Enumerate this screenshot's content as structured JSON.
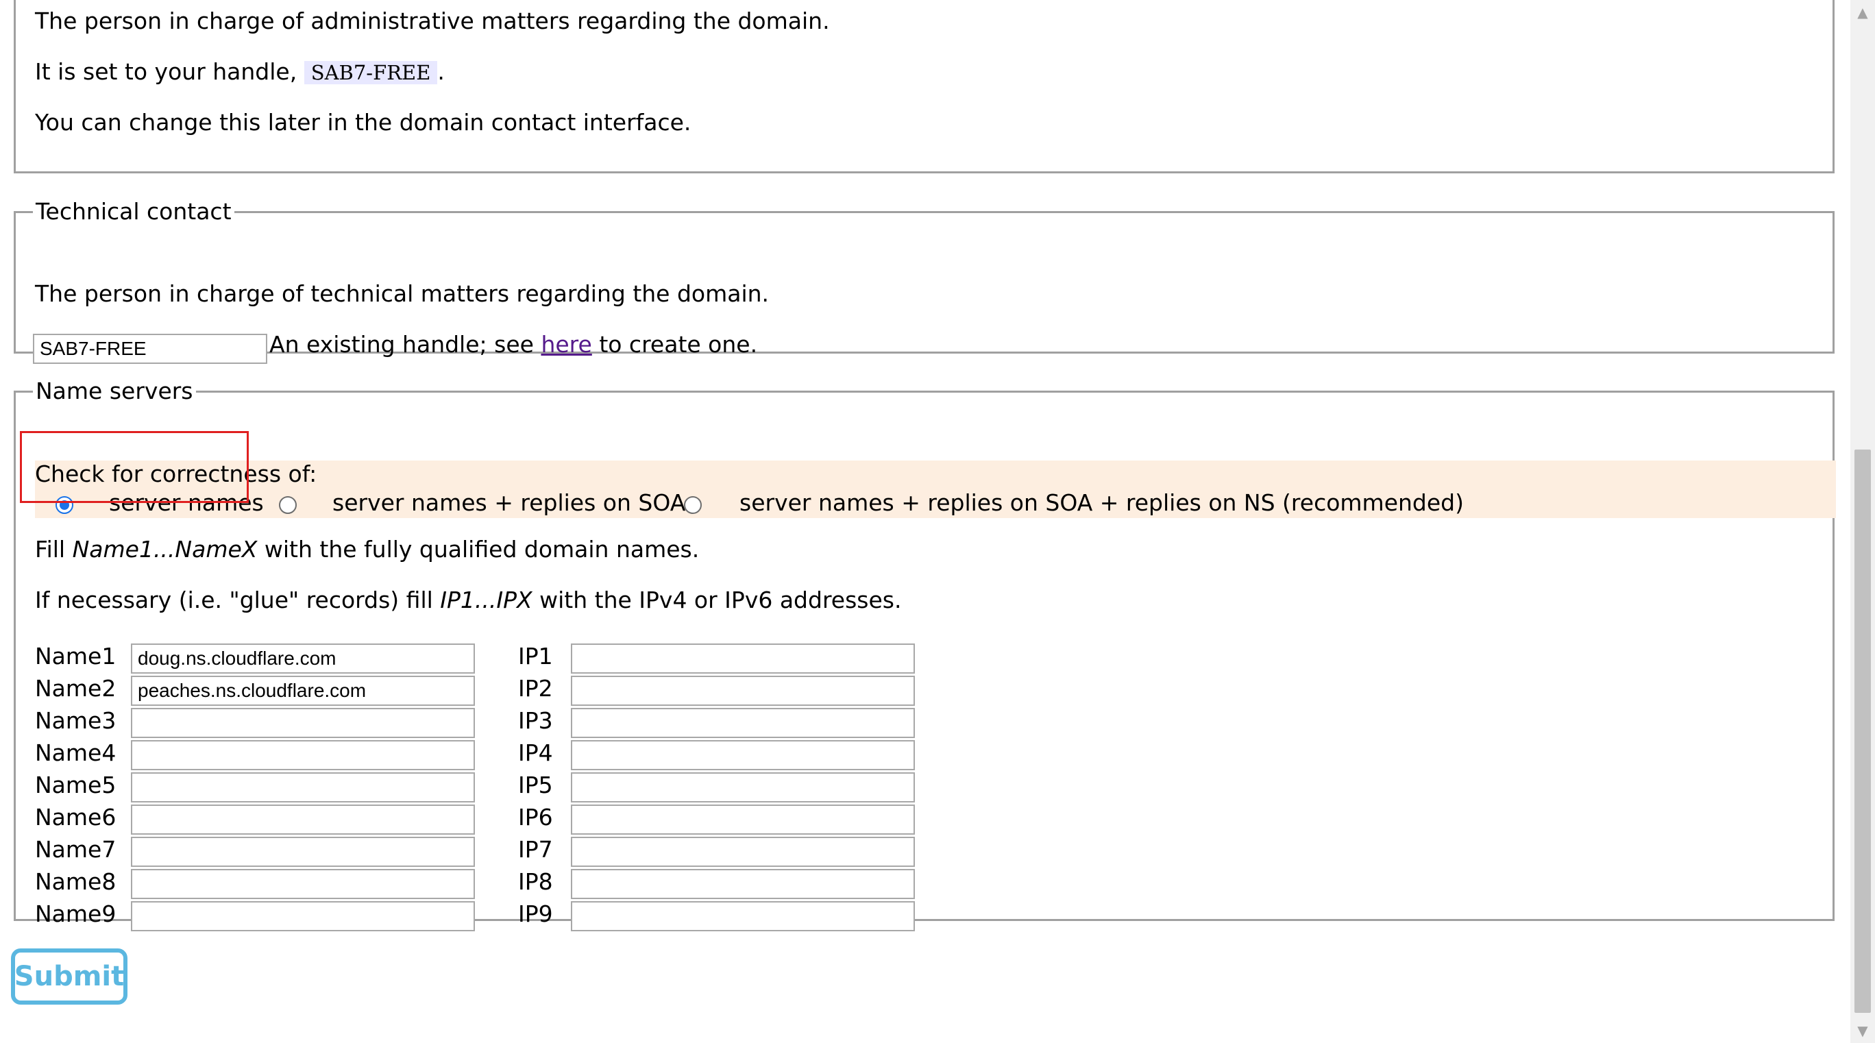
{
  "admin_contact": {
    "description": "The person in charge of administrative matters regarding the domain.",
    "handle_prefix": "It is set to your handle,",
    "handle": "SAB7-FREE",
    "handle_suffix": ".",
    "change_note": "You can change this later in the domain contact interface."
  },
  "technical_contact": {
    "legend": "Technical contact",
    "description": "The person in charge of technical matters regarding the domain.",
    "handle_value": "SAB7-FREE",
    "help_prefix": "An existing handle; see",
    "help_link": "here",
    "help_suffix": "to create one."
  },
  "name_servers": {
    "legend": "Name servers",
    "check_label": "Check for correctness of:",
    "options": [
      {
        "label": "server names",
        "checked": true
      },
      {
        "label": "server names + replies on SOA",
        "checked": false
      },
      {
        "label": "server names + replies on SOA + replies on NS (recommended)",
        "checked": false
      }
    ],
    "fill_prefix": "Fill",
    "fill_em": "Name1...NameX",
    "fill_suffix": "with the fully qualified domain names.",
    "glue_prefix": "If necessary (i.e. \"glue\" records) fill",
    "glue_em": "IP1...IPX",
    "glue_suffix": "with the IPv4 or IPv6 addresses.",
    "rows": [
      {
        "name_label": "Name1",
        "name_value": "doug.ns.cloudflare.com",
        "ip_label": "IP1",
        "ip_value": ""
      },
      {
        "name_label": "Name2",
        "name_value": "peaches.ns.cloudflare.com",
        "ip_label": "IP2",
        "ip_value": ""
      },
      {
        "name_label": "Name3",
        "name_value": "",
        "ip_label": "IP3",
        "ip_value": ""
      },
      {
        "name_label": "Name4",
        "name_value": "",
        "ip_label": "IP4",
        "ip_value": ""
      },
      {
        "name_label": "Name5",
        "name_value": "",
        "ip_label": "IP5",
        "ip_value": ""
      },
      {
        "name_label": "Name6",
        "name_value": "",
        "ip_label": "IP6",
        "ip_value": ""
      },
      {
        "name_label": "Name7",
        "name_value": "",
        "ip_label": "IP7",
        "ip_value": ""
      },
      {
        "name_label": "Name8",
        "name_value": "",
        "ip_label": "IP8",
        "ip_value": ""
      },
      {
        "name_label": "Name9",
        "name_value": "",
        "ip_label": "IP9",
        "ip_value": ""
      }
    ]
  },
  "submit_label": "Submit",
  "colors": {
    "radio_band": "#fdeee0",
    "highlight": "#e02020",
    "submit": "#5bb7e0",
    "link": "#551a8b",
    "handle_chip": "#e8e8ff"
  }
}
